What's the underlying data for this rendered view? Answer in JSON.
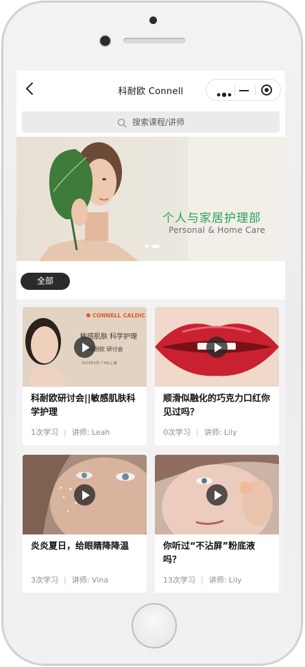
{
  "navbar": {
    "title": "科耐欧 Connell"
  },
  "search": {
    "placeholder": "搜索课程/讲师"
  },
  "banner": {
    "title": "个人与家居护理部",
    "subtitle": "Personal & Home Care",
    "pagination": {
      "count": 2,
      "active_index": 1
    }
  },
  "filter": {
    "chips": [
      {
        "label": "全部",
        "selected": true
      }
    ]
  },
  "courses": [
    {
      "title": "科耐欧研讨会||敏感肌肤科学护理",
      "learn_count": "1次学习",
      "teacher": "讲师: Leah",
      "thumb_brand": "CONNELL CALDIC",
      "thumb_line1": "敏感肌肤 科学护理",
      "thumb_line2": "科耐欧 研讨会",
      "thumb_line3": "2023年1月 广州&上海"
    },
    {
      "title": "顺滑似融化的巧克力口红你见过吗？",
      "learn_count": "0次学习",
      "teacher": "讲师: Lily"
    },
    {
      "title": "炎炎夏日，给眼睛降降温",
      "learn_count": "3次学习",
      "teacher": "讲师: Vina"
    },
    {
      "title": "你听过“不沾屏”粉底液吗？",
      "learn_count": "13次学习",
      "teacher": "讲师: Lily"
    }
  ],
  "colors": {
    "banner_title": "#27a05e",
    "chip_bg": "#2b2b2b",
    "screen_bg": "#f2f2f2"
  },
  "icons": [
    "back-arrow-icon",
    "more-dots-icon",
    "minimize-icon",
    "close-circle-icon",
    "search-icon",
    "play-icon"
  ]
}
